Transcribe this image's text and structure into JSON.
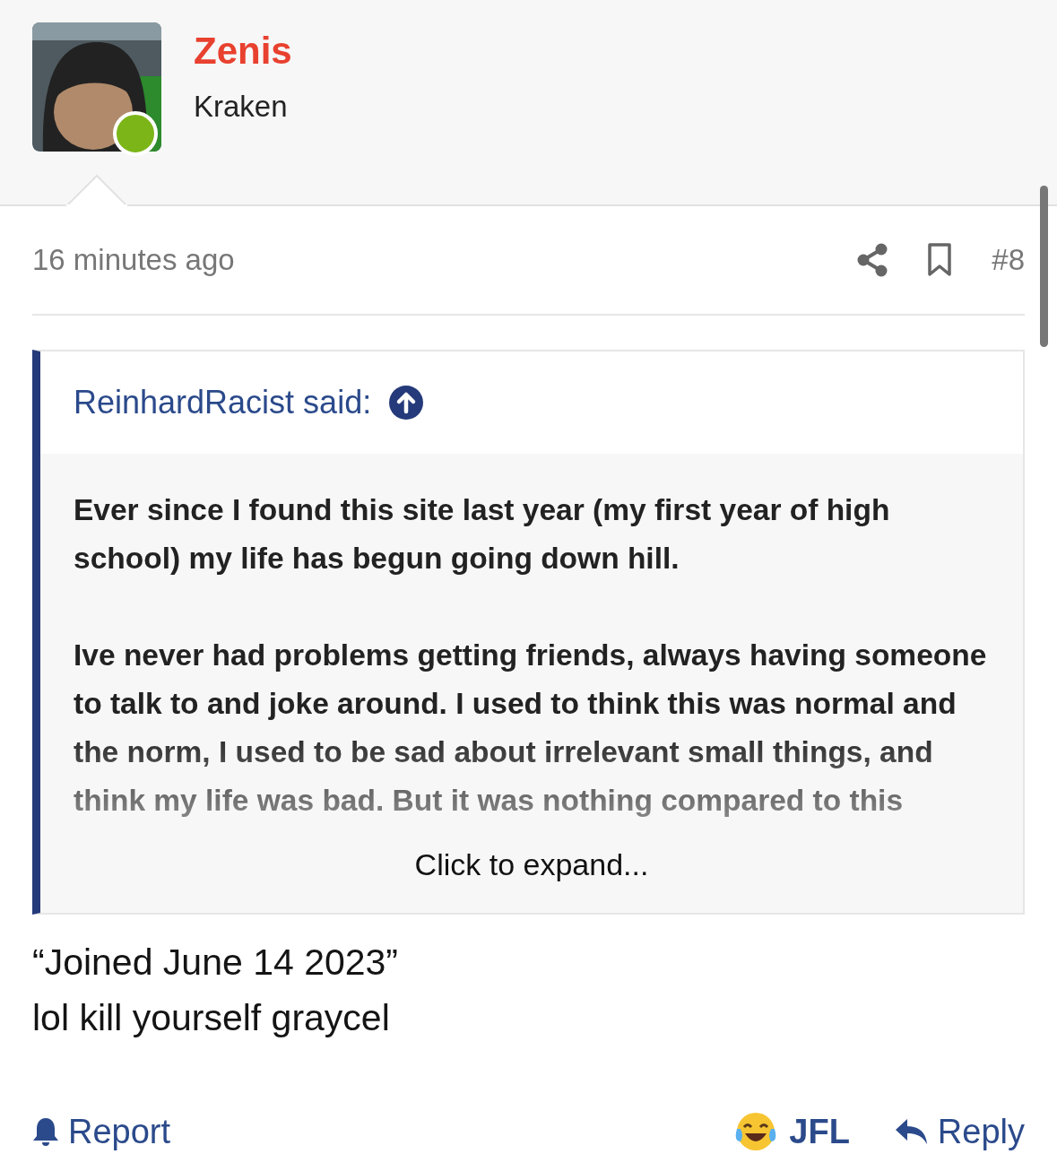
{
  "author": {
    "name": "Zenis",
    "title": "Kraken",
    "online": true
  },
  "post": {
    "time": "16 minutes ago",
    "number": "#8"
  },
  "quote": {
    "author_line": "ReinhardRacist said:",
    "paragraphs": [
      "Ever since I found this site last year (my first year of high school) my life has begun going down hill.",
      "Ive never had problems getting friends, always having someone to talk to and joke around. I used to think this was normal and the norm, I used to be sad about irrelevant small things, and think my life was bad. But it was nothing compared to this"
    ],
    "expand_label": "Click to expand..."
  },
  "message": [
    "“Joined June 14 2023”",
    "lol kill yourself graycel"
  ],
  "actions": [
    {
      "kind": "report",
      "label": "Report"
    },
    {
      "kind": "reaction",
      "label": "JFL"
    },
    {
      "kind": "reply",
      "label": "Reply"
    }
  ]
}
